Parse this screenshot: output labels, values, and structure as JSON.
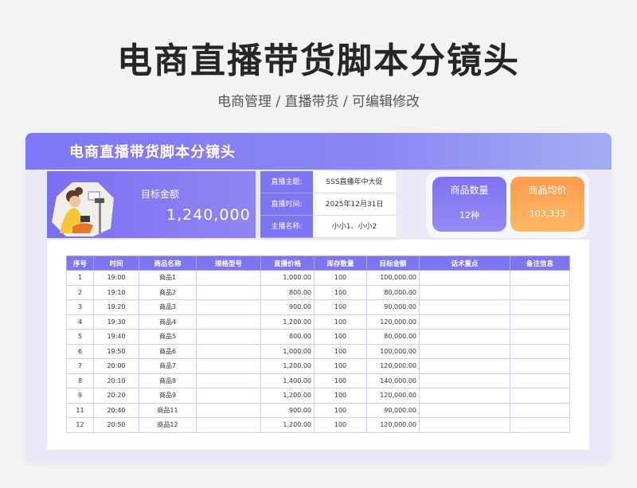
{
  "page": {
    "title": "电商直播带货脚本分镜头",
    "subtitle": "电商管理 / 直播带货 /  可编辑修改"
  },
  "card": {
    "title": "电商直播带货脚本分镜头"
  },
  "target": {
    "label": "目标金额",
    "value": "1,240,000"
  },
  "info": [
    {
      "key": "直播主题:",
      "value": "SSS直播年中大促"
    },
    {
      "key": "直播时间:",
      "value": "2025年12月31日"
    },
    {
      "key": "主播名称:",
      "value": "小小1、小小2"
    }
  ],
  "stats": {
    "count": {
      "label": "商品数量",
      "value": "12种"
    },
    "avg": {
      "label": "商品均价",
      "value": "103,333"
    }
  },
  "table": {
    "headers": [
      "序号",
      "时间",
      "商品名称",
      "规格型号",
      "直播价格",
      "库存数量",
      "目标金额",
      "话术重点",
      "备注信息"
    ],
    "rows": [
      [
        "1",
        "19:00",
        "商品1",
        "",
        "1,000.00",
        "100",
        "100,000.00",
        "",
        ""
      ],
      [
        "2",
        "19:10",
        "商品2",
        "",
        "800.00",
        "100",
        "80,000.00",
        "",
        ""
      ],
      [
        "3",
        "19:20",
        "商品3",
        "",
        "900.00",
        "100",
        "90,000.00",
        "",
        ""
      ],
      [
        "4",
        "19:30",
        "商品4",
        "",
        "1,200.00",
        "100",
        "120,000.00",
        "",
        ""
      ],
      [
        "5",
        "19:40",
        "商品5",
        "",
        "800.00",
        "100",
        "80,000.00",
        "",
        ""
      ],
      [
        "6",
        "19:50",
        "商品6",
        "",
        "1,000.00",
        "100",
        "100,000.00",
        "",
        ""
      ],
      [
        "7",
        "20:00",
        "商品7",
        "",
        "1,200.00",
        "100",
        "120,000.00",
        "",
        ""
      ],
      [
        "8",
        "20:10",
        "商品8",
        "",
        "1,400.00",
        "100",
        "140,000.00",
        "",
        ""
      ],
      [
        "9",
        "20:20",
        "商品9",
        "",
        "1,200.00",
        "100",
        "120,000.00",
        "",
        ""
      ],
      [
        "11",
        "20:40",
        "商品11",
        "",
        "900.00",
        "100",
        "90,000.00",
        "",
        ""
      ],
      [
        "12",
        "20:50",
        "商品12",
        "",
        "1,200.00",
        "100",
        "120,000.00",
        "",
        ""
      ]
    ]
  },
  "colors": {
    "primary": "#7e76f1",
    "accent_orange": "#ffa959"
  }
}
